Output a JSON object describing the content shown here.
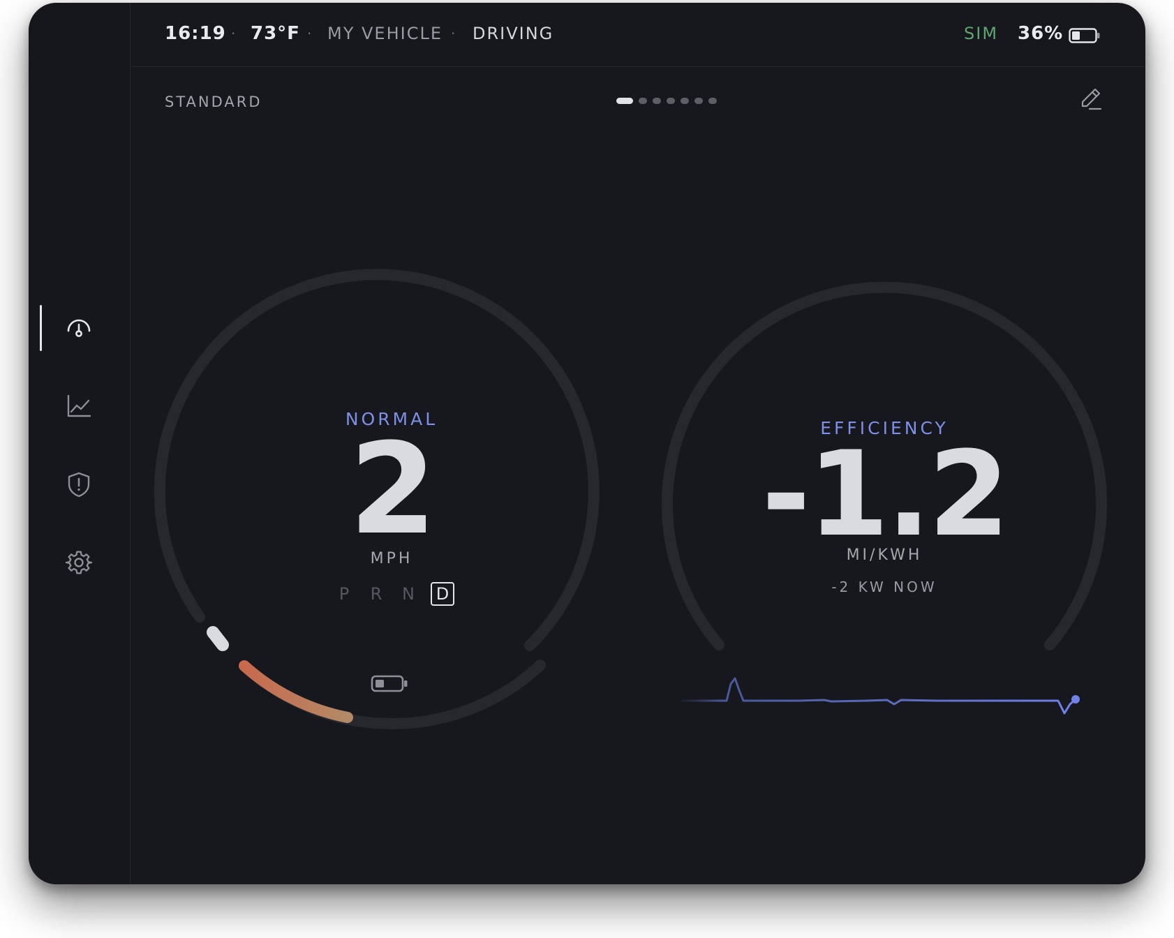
{
  "status_bar": {
    "time": "16:19",
    "temperature": "73°F",
    "vehicle": "MY VEHICLE",
    "state": "DRIVING",
    "separator": "·",
    "sim_label": "SIM",
    "battery_percent": "36%",
    "battery_level": 0.36
  },
  "sidebar": {
    "items": [
      {
        "name": "gauges",
        "icon": "speedometer-icon",
        "active": true
      },
      {
        "name": "charts",
        "icon": "line-chart-icon",
        "active": false
      },
      {
        "name": "alerts",
        "icon": "shield-alert-icon",
        "active": false
      },
      {
        "name": "settings",
        "icon": "gear-icon",
        "active": false
      }
    ]
  },
  "layout_header": {
    "label": "STANDARD",
    "page_count": 7,
    "active_page": 1,
    "edit_icon": "pencil-icon"
  },
  "speed_gauge": {
    "mode": "NORMAL",
    "value": "2",
    "unit": "MPH",
    "gears": [
      "P",
      "R",
      "N",
      "D"
    ],
    "selected_gear": "D",
    "battery_icon": "battery-icon",
    "colors": {
      "mode": "#7e8fe6",
      "arc_start": "#c8694e",
      "arc_end": "#b38a66"
    }
  },
  "efficiency_gauge": {
    "label": "EFFICIENCY",
    "value": "-1.2",
    "unit": "MI/KWH",
    "power": "-2 KW NOW",
    "colors": {
      "label": "#7e8fe6",
      "line": "#6f82e8"
    }
  }
}
